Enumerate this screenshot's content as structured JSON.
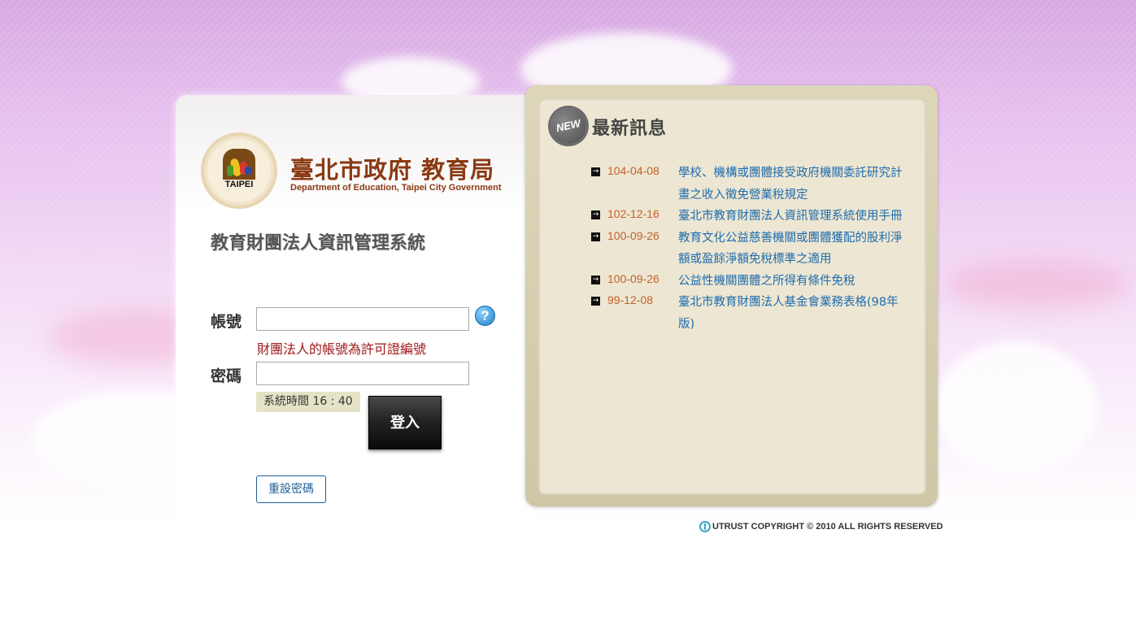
{
  "organization": {
    "logo_text": "TAIPEI",
    "name": "臺北市政府 教育局",
    "subtitle": "Department of Education, Taipei City Government"
  },
  "system_title": "教育財團法人資訊管理系統",
  "login": {
    "account_label": "帳號",
    "account_value": "",
    "account_hint": "財團法人的帳號為許可證編號",
    "password_label": "密碼",
    "password_value": "",
    "help_label": "?",
    "system_time": "系統時間 16 : 40",
    "login_button": "登入",
    "reset_button": "重設密碼"
  },
  "news": {
    "badge": "NEW",
    "title": "最新訊息",
    "items": [
      {
        "date": "104-04-08",
        "text": "學校、機構或團體接受政府機關委託研究計畫之收入徵免營業稅規定"
      },
      {
        "date": "102-12-16",
        "text": "臺北市教育財團法人資訊管理系統使用手冊"
      },
      {
        "date": "100-09-26",
        "text": "教育文化公益慈善機關或團體獲配的股利淨額或盈餘淨額免稅標準之適用"
      },
      {
        "date": "100-09-26",
        "text": "公益性機關團體之所得有條件免稅"
      },
      {
        "date": "99-12-08",
        "text": "臺北市教育財團法人基金會業務表格(98年版)"
      }
    ]
  },
  "footer": {
    "copyright": "UTRUST COPYRIGHT © 2010 ALL RIGHTS RESERVED"
  }
}
